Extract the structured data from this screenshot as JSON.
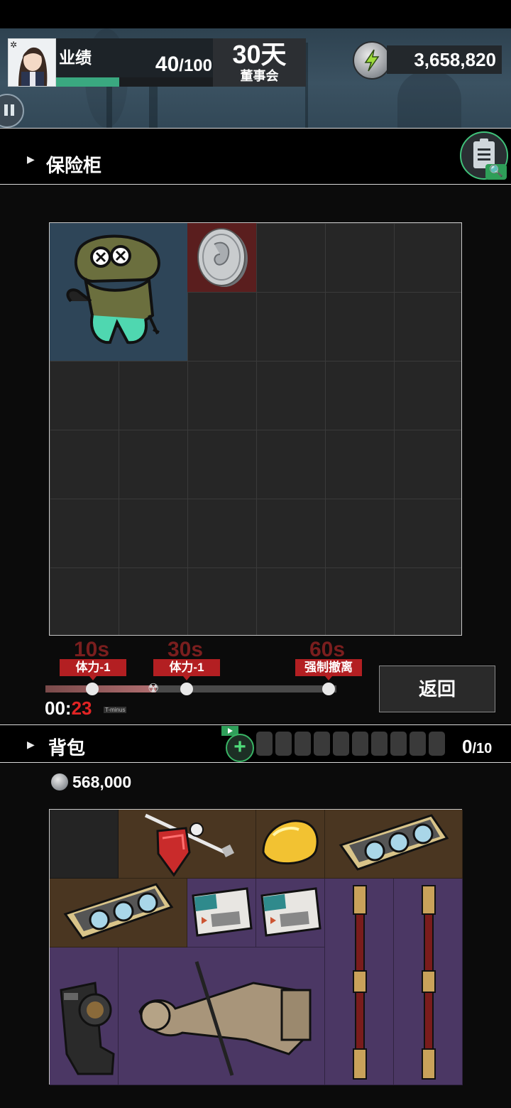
{
  "header": {
    "performance_label": "业绩",
    "performance_value": "40",
    "performance_max": "/100",
    "performance_progress": 0.4,
    "days_value": "30天",
    "days_label": "董事会",
    "currency_total": "3,658,820"
  },
  "safe": {
    "title": "保险柜",
    "columns": 6,
    "rows": 6,
    "items": [
      {
        "name": "frog-soldier-figure",
        "rarity_color": "#2e4558"
      },
      {
        "name": "silver-coin",
        "rarity_color": "#5a1e1e"
      }
    ]
  },
  "timer": {
    "milestones": [
      {
        "time": "10s",
        "effect": "体力-1"
      },
      {
        "time": "30s",
        "effect": "体力-1"
      },
      {
        "time": "60s",
        "effect": "强制撤离"
      }
    ],
    "clock_prefix": "00:",
    "clock_seconds": "23",
    "tminus_label": "T-minus",
    "elapsed_fraction": 0.38
  },
  "return_button": "返回",
  "backpack": {
    "title": "背包",
    "capacity_used": "0",
    "capacity_max": "/10",
    "money": "568,000",
    "items": [
      {
        "name": "ruby-pick",
        "rarity_color": "#4a3621"
      },
      {
        "name": "gold-bun",
        "rarity_color": "#4a3621"
      },
      {
        "name": "graphics-card",
        "rarity_color": "#4a3621"
      },
      {
        "name": "graphics-card",
        "rarity_color": "#4a3621"
      },
      {
        "name": "film-ticket",
        "rarity_color": "#4b3764"
      },
      {
        "name": "film-ticket",
        "rarity_color": "#4b3764"
      },
      {
        "name": "ornate-staff",
        "rarity_color": "#4b3764"
      },
      {
        "name": "ornate-staff",
        "rarity_color": "#4b3764"
      },
      {
        "name": "camera",
        "rarity_color": "#4b3764"
      },
      {
        "name": "terracotta-statue",
        "rarity_color": "#4b3764"
      }
    ]
  },
  "colors": {
    "accent_green": "#3aa880",
    "danger_red": "#b31f22"
  }
}
